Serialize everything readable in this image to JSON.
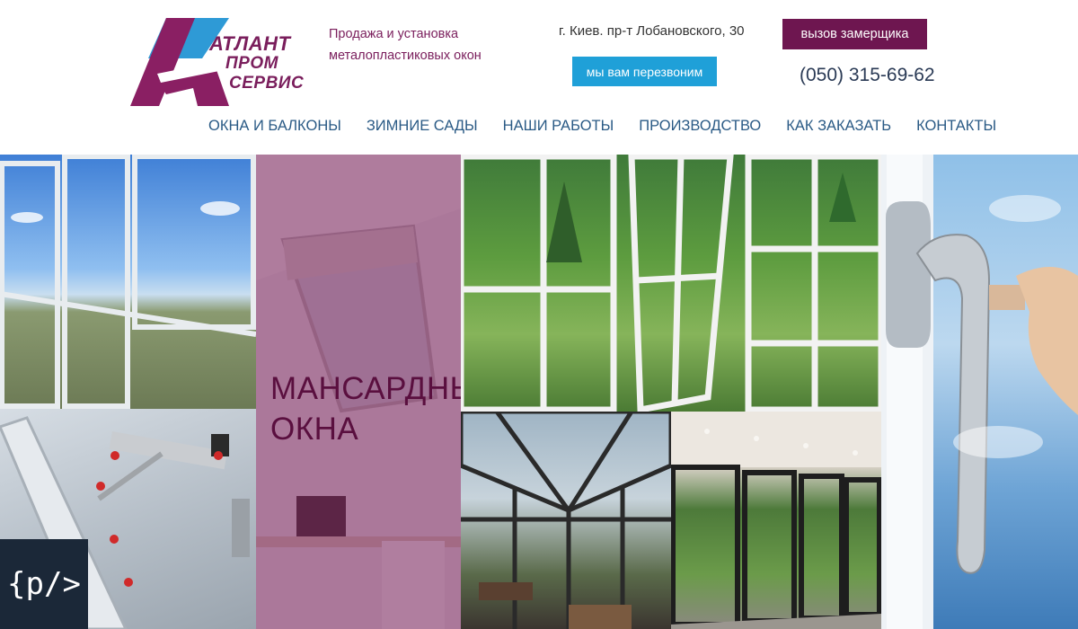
{
  "brand": {
    "logo_line1": "АТЛАНТ",
    "logo_line2": "ПРОМ",
    "logo_line3": "СЕРВИС"
  },
  "header": {
    "tagline_line1": "Продажа и установка",
    "tagline_line2": "металопластиковых окон",
    "address": "г. Киев. пр-т Лобановского, 30",
    "callback_label": "мы вам перезвоним",
    "measure_label": "вызов замерщика",
    "phone": "(050) 315-69-62"
  },
  "nav": {
    "items": [
      {
        "label": "ОКНА И БАЛКОНЫ"
      },
      {
        "label": "ЗИМНИЕ САДЫ"
      },
      {
        "label": "НАШИ РАБОТЫ"
      },
      {
        "label": "ПРОИЗВОДСТВО"
      },
      {
        "label": "КАК ЗАКАЗАТЬ"
      },
      {
        "label": "КОНТАКТЫ"
      }
    ]
  },
  "gallery": {
    "attic_title_line1": "МАНСАРДНЫЕ",
    "attic_title_line2": "ОКНА"
  },
  "badge": {
    "label": "{p/>"
  },
  "colors": {
    "brand_purple": "#6e1650",
    "accent_blue": "#1fa0d8",
    "nav_blue": "#2a5a85"
  }
}
